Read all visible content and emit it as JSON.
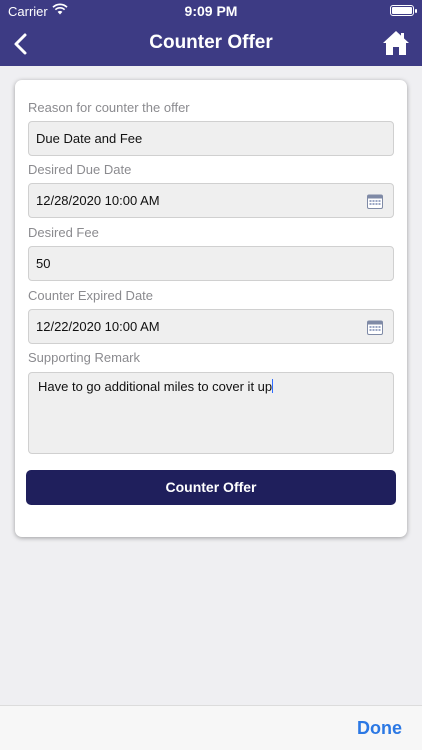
{
  "status_bar": {
    "carrier": "Carrier",
    "time": "9:09 PM"
  },
  "nav": {
    "title": "Counter Offer",
    "back_icon": "chevron-left-icon",
    "home_icon": "home-icon"
  },
  "form": {
    "reason_label": "Reason for counter the offer",
    "reason_value": "Due Date and Fee",
    "due_date_label": "Desired Due Date",
    "due_date_value": "12/28/2020 10:00 AM",
    "fee_label": "Desired Fee",
    "fee_value": "50",
    "expired_label": "Counter Expired Date",
    "expired_value": "12/22/2020 10:00 AM",
    "remark_label": "Supporting Remark",
    "remark_value": "Have to go additional miles to cover it up",
    "submit_label": "Counter Offer"
  },
  "keyboard_toolbar": {
    "done_label": "Done"
  },
  "colors": {
    "nav_bg": "#3d3b84",
    "button_bg": "#1f1f5c",
    "done": "#2b78e4"
  }
}
